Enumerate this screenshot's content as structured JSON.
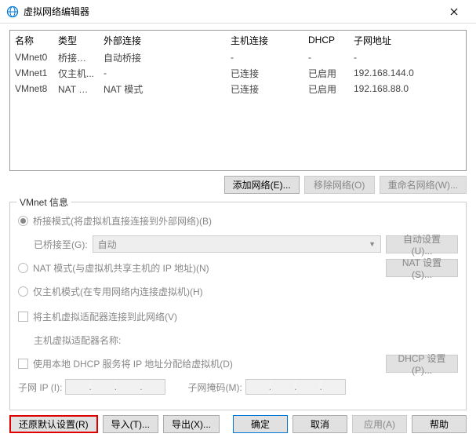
{
  "title": "虚拟网络编辑器",
  "table": {
    "headers": {
      "name": "名称",
      "type": "类型",
      "ext": "外部连接",
      "host": "主机连接",
      "dhcp": "DHCP",
      "subnet": "子网地址"
    },
    "rows": [
      {
        "name": "VMnet0",
        "type": "桥接模式",
        "ext": "自动桥接",
        "host": "-",
        "dhcp": "-",
        "subnet": "-"
      },
      {
        "name": "VMnet1",
        "type": "仅主机...",
        "ext": "-",
        "host": "已连接",
        "dhcp": "已启用",
        "subnet": "192.168.144.0"
      },
      {
        "name": "VMnet8",
        "type": "NAT 模式",
        "ext": "NAT 模式",
        "host": "已连接",
        "dhcp": "已启用",
        "subnet": "192.168.88.0"
      }
    ]
  },
  "buttons": {
    "add": "添加网络(E)...",
    "remove": "移除网络(O)",
    "rename": "重命名网络(W)..."
  },
  "group": {
    "title": "VMnet 信息",
    "bridge_radio": "桥接模式(将虚拟机直接连接到外部网络)(B)",
    "bridge_to_label": "已桥接至(G):",
    "bridge_select": "自动",
    "auto_settings": "自动设置(U)...",
    "nat_radio": "NAT 模式(与虚拟机共享主机的 IP 地址)(N)",
    "nat_settings": "NAT 设置(S)...",
    "hostonly_radio": "仅主机模式(在专用网络内连接虚拟机)(H)",
    "host_check": "将主机虚拟适配器连接到此网络(V)",
    "host_adapter_label": "主机虚拟适配器名称:",
    "dhcp_check": "使用本地 DHCP 服务将 IP 地址分配给虚拟机(D)",
    "dhcp_settings": "DHCP 设置(P)...",
    "subnet_ip_label": "子网 IP (I):",
    "subnet_mask_label": "子网掩码(M):"
  },
  "footer": {
    "restore": "还原默认设置(R)",
    "import": "导入(T)...",
    "export": "导出(X)...",
    "ok": "确定",
    "cancel": "取消",
    "apply": "应用(A)",
    "help": "帮助"
  }
}
